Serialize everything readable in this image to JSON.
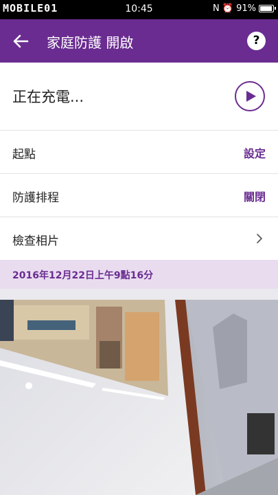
{
  "status_bar": {
    "carrier_logo": "MOBILE01",
    "time": "10:45",
    "indicators": "N  ⏰",
    "battery": "91%",
    "battery_level": 0.91
  },
  "app_bar": {
    "title": "家庭防護 開啟",
    "back_icon": "arrow-left-icon",
    "help_label": "?"
  },
  "device_status": {
    "text": "正在充電...",
    "action_icon": "play-icon"
  },
  "settings": [
    {
      "label": "起點",
      "value": "設定"
    },
    {
      "label": "防護排程",
      "value": "關閉"
    },
    {
      "label": "檢查相片",
      "value": ""
    }
  ],
  "photo": {
    "timestamp": "2016年12月22日上午9點16分",
    "image_description": "camera-snapshot"
  },
  "colors": {
    "accent": "#6a2c91",
    "date_bar_bg": "#e9dcef"
  }
}
